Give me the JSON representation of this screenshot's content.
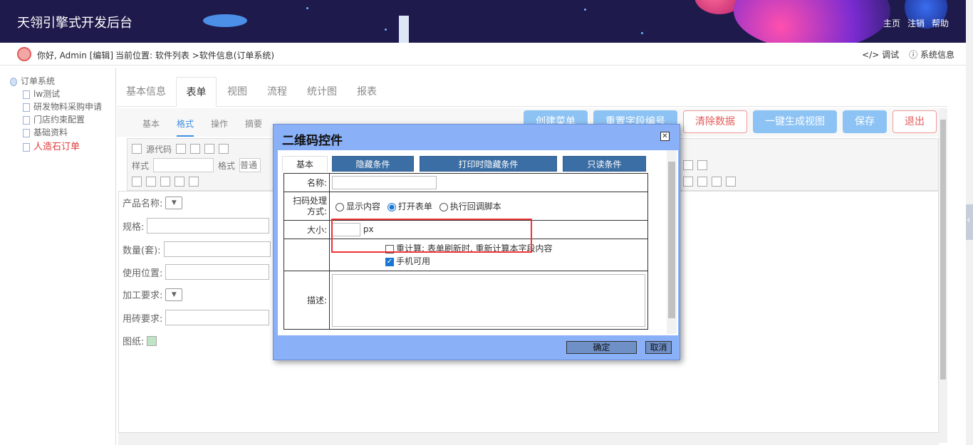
{
  "header": {
    "title": "天翎引擎式开发后台",
    "nav": [
      "主页",
      "注销",
      "帮助"
    ]
  },
  "subheader": {
    "hello": "你好, Admin [编辑]",
    "position": "当前位置: 软件列表 >软件信息(订单系统)",
    "debug": "调试",
    "sysinfo": "系统信息"
  },
  "tree": {
    "root": "订单系统",
    "items": [
      "lw测试",
      "研发物料采购申请",
      "门店约束配置",
      "基础资料",
      "人造石订单"
    ]
  },
  "tabs": [
    "基本信息",
    "表单",
    "视图",
    "流程",
    "统计图",
    "报表"
  ],
  "subtabs": [
    "基本",
    "格式",
    "操作",
    "摘要"
  ],
  "buttons": {
    "create_menu": "创建菜单",
    "reset_fields": "重置字段编号",
    "clear_data": "清除数据",
    "gen_view": "一键生成视图",
    "save": "保存",
    "exit": "退出"
  },
  "toolbar": {
    "source": "源代码",
    "style": "样式",
    "format": "格式",
    "format_val": "普通"
  },
  "form": {
    "product": "产品名称:",
    "spec": "规格:",
    "qty": "数量(套):",
    "location": "使用位置:",
    "process": "加工要求:",
    "brick": "用砖要求:",
    "drawing": "图纸:"
  },
  "modal": {
    "title": "二维码控件",
    "tabs": [
      "基本",
      "隐藏条件",
      "打印时隐藏条件",
      "只读条件"
    ],
    "name_label": "名称:",
    "scan_label": "扫码处理方式:",
    "scan_label_1": "扫码处理",
    "scan_label_2": "方式:",
    "options": [
      "显示内容",
      "打开表单",
      "执行回调脚本"
    ],
    "size_label": "大小:",
    "size_unit": "px",
    "recalc": "重计算: 表单刷新时, 重新计算本字段内容",
    "mobile": "手机可用",
    "desc_label": "描述:",
    "ok": "确定",
    "cancel": "取消"
  }
}
